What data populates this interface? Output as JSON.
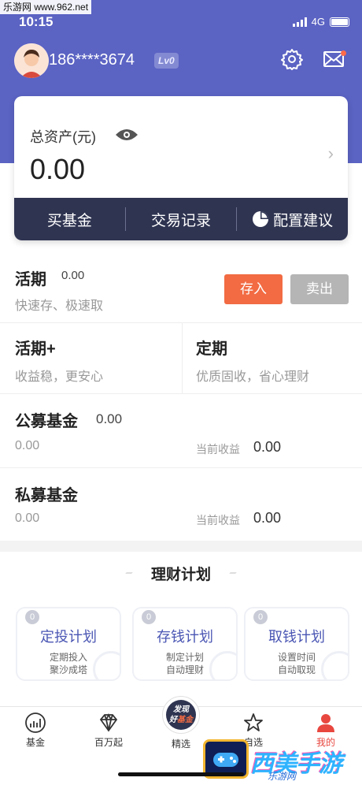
{
  "watermark": "乐游网 www.962.net",
  "status": {
    "time": "10:15",
    "network": "4G"
  },
  "header": {
    "phone": "186****3674",
    "level": "Lv0"
  },
  "asset": {
    "label": "总资产(元)",
    "value": "0.00"
  },
  "actions": [
    "买基金",
    "交易记录",
    "配置建议"
  ],
  "current": {
    "title": "活期",
    "value": "0.00",
    "subtitle": "快速存、极速取",
    "deposit": "存入",
    "withdraw": "卖出"
  },
  "current_plus": {
    "title": "活期+",
    "subtitle": "收益稳，更安心"
  },
  "fixed": {
    "title": "定期",
    "subtitle": "优质固收，省心理财"
  },
  "public_fund": {
    "title": "公募基金",
    "value": "0.00",
    "amount": "0.00",
    "income_label": "当前收益",
    "income": "0.00"
  },
  "private_fund": {
    "title": "私募基金",
    "amount": "0.00",
    "income_label": "当前收益",
    "income": "0.00"
  },
  "plans": {
    "title": "理财计划",
    "items": [
      {
        "num": "0",
        "name": "定投计划",
        "desc1": "定期投入",
        "desc2": "聚沙成塔"
      },
      {
        "num": "0",
        "name": "存钱计划",
        "desc1": "制定计划",
        "desc2": "自动理财"
      },
      {
        "num": "0",
        "name": "取钱计划",
        "desc1": "设置时间",
        "desc2": "自动取现"
      }
    ]
  },
  "tabs": [
    "基金",
    "百万起",
    "精选",
    "自选",
    "我的"
  ],
  "center_badge": {
    "line1": "发现",
    "line2a": "好",
    "line2b": "基金"
  },
  "logo": {
    "text": "西美手游网",
    "sub": "乐游网"
  },
  "colors": {
    "primary": "#5b63c3",
    "dark": "#2f3451",
    "accent": "#f26b43",
    "active_tab": "#e8473f"
  }
}
